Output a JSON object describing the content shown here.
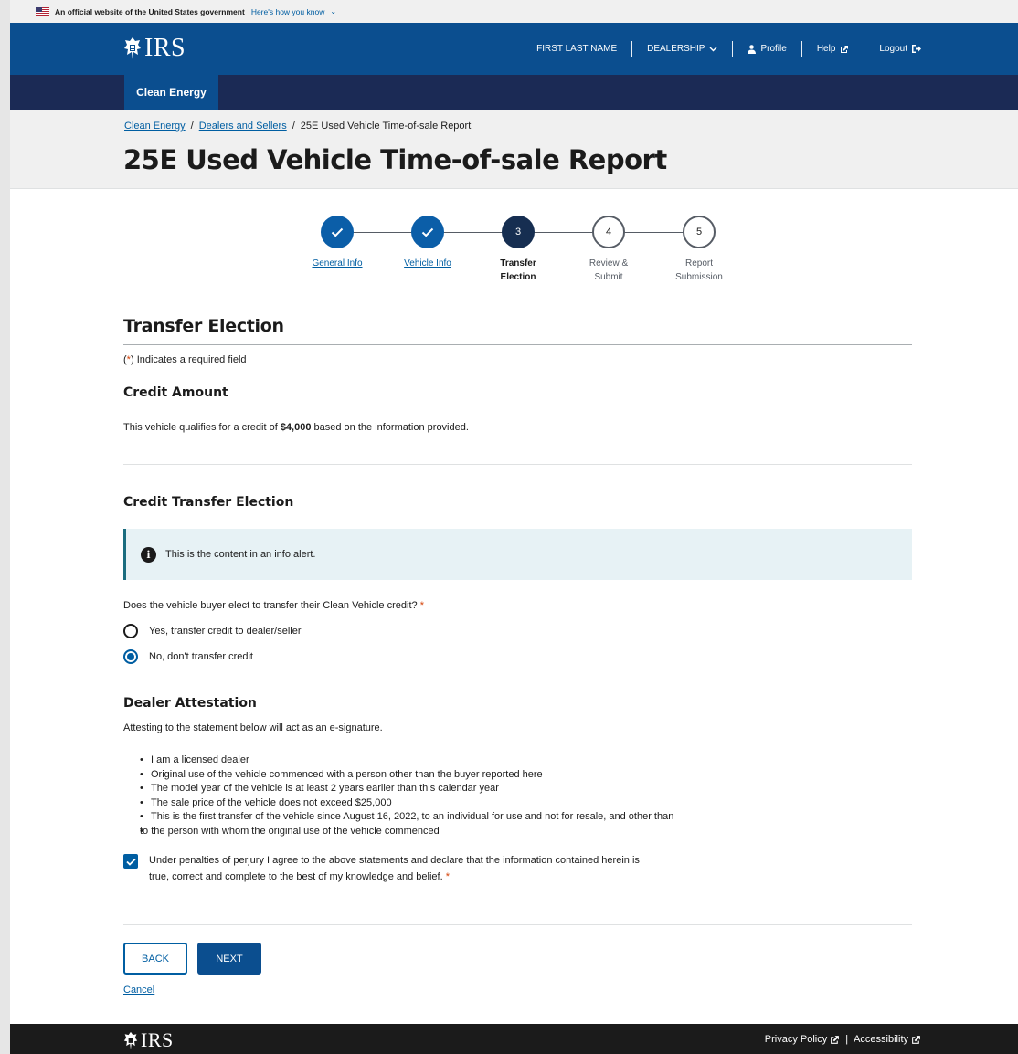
{
  "gov_banner": {
    "text": "An official website of the United States government",
    "link": "Here's how you know"
  },
  "header": {
    "logo": "IRS",
    "user_name": "FIRST LAST NAME",
    "dealership": "DEALERSHIP",
    "profile": "Profile",
    "help": "Help",
    "logout": "Logout"
  },
  "subnav": {
    "active_tab": "Clean Energy"
  },
  "breadcrumb": {
    "items": [
      "Clean Energy",
      "Dealers and Sellers",
      "25E Used Vehicle Time-of-sale Report"
    ],
    "separator": "/"
  },
  "page_title": "25E Used Vehicle Time-of-sale Report",
  "stepper": {
    "steps": [
      {
        "label": "General Info",
        "state": "complete"
      },
      {
        "label": "Vehicle Info",
        "state": "complete"
      },
      {
        "number": "3",
        "label_line1": "Transfer",
        "label_line2": "Election",
        "state": "current"
      },
      {
        "number": "4",
        "label_line1": "Review &",
        "label_line2": "Submit",
        "state": "upcoming"
      },
      {
        "number": "5",
        "label_line1": "Report",
        "label_line2": "Submission",
        "state": "upcoming"
      }
    ]
  },
  "form": {
    "section_title": "Transfer Election",
    "required_note_star": "*",
    "required_note_text": "Indicates a required field",
    "credit_amount": {
      "heading": "Credit Amount",
      "text_before": "This vehicle qualifies for a credit of ",
      "amount": "$4,000",
      "text_after": " based on the information provided."
    },
    "credit_transfer": {
      "heading": "Credit Transfer Election",
      "alert_text": "This is the content in an info alert.",
      "question": "Does the vehicle buyer elect to transfer their Clean Vehicle credit?",
      "options": [
        {
          "label": "Yes, transfer credit to dealer/seller",
          "selected": false
        },
        {
          "label": "No, don't transfer credit",
          "selected": true
        }
      ]
    },
    "attestation": {
      "heading": "Dealer Attestation",
      "intro": "Attesting to the statement below will act as an e-signature.",
      "statements": [
        "I am a licensed dealer",
        "Original use of the vehicle commenced with a person other than the buyer reported here",
        "The model year of the vehicle is at least 2 years earlier than this calendar year",
        "The sale price of the vehicle does not exceed $25,000",
        "This is the first transfer of the vehicle since August 16, 2022, to an individual for use and not for resale, and other than",
        "to the person with whom the original use of the vehicle commenced"
      ],
      "checkbox_line1": "Under penalties of perjury I agree to the above statements and declare that the information contained herein is",
      "checkbox_line2": "true, correct and complete to the best of my knowledge and belief.",
      "checked": true
    },
    "buttons": {
      "back": "BACK",
      "next": "NEXT",
      "cancel": "Cancel"
    }
  },
  "footer": {
    "logo": "IRS",
    "privacy": "Privacy Policy",
    "separator": "|",
    "accessibility": "Accessibility"
  },
  "colors": {
    "header_blue": "#0b4e8f",
    "subnav_navy": "#1b2a55",
    "link_blue": "#005ea2",
    "step_current": "#162e51",
    "alert_bg": "#e7f2f5",
    "required_red": "#d54309"
  }
}
